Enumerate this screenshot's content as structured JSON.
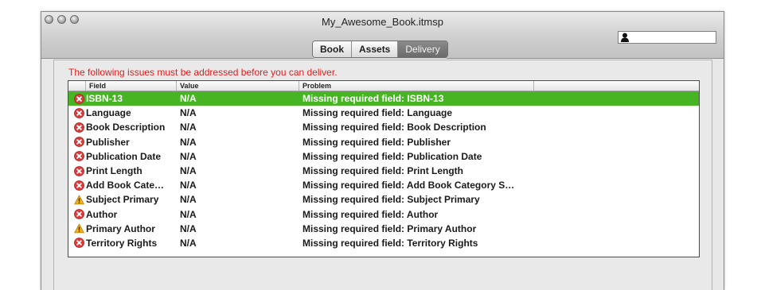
{
  "window": {
    "title": "My_Awesome_Book.itmsp"
  },
  "tabs": [
    {
      "label": "Book",
      "active": false
    },
    {
      "label": "Assets",
      "active": false
    },
    {
      "label": "Delivery",
      "active": true
    }
  ],
  "warning": "The following issues must be addressed before you can deliver.",
  "table": {
    "headers": {
      "field": "Field",
      "value": "Value",
      "problem": "Problem"
    },
    "rows": [
      {
        "icon": "error-icon",
        "field": "ISBN-13",
        "value": "N/A",
        "problem": "Missing required field: ISBN-13",
        "selected": true
      },
      {
        "icon": "error-icon",
        "field": "Language",
        "value": "N/A",
        "problem": "Missing required field: Language"
      },
      {
        "icon": "error-icon",
        "field": "Book Description",
        "value": "N/A",
        "problem": "Missing required field: Book Description"
      },
      {
        "icon": "error-icon",
        "field": "Publisher",
        "value": "N/A",
        "problem": "Missing required field: Publisher"
      },
      {
        "icon": "error-icon",
        "field": "Publication Date",
        "value": "N/A",
        "problem": "Missing required field: Publication Date"
      },
      {
        "icon": "error-icon",
        "field": "Print Length",
        "value": "N/A",
        "problem": "Missing required field: Print Length"
      },
      {
        "icon": "error-icon",
        "field": "Add Book Cate…",
        "value": "N/A",
        "problem": "Missing required field: Add Book Category S…"
      },
      {
        "icon": "warning-icon",
        "field": "Subject Primary",
        "value": "N/A",
        "problem": "Missing required field: Subject Primary"
      },
      {
        "icon": "error-icon",
        "field": "Author",
        "value": "N/A",
        "problem": "Missing required field: Author"
      },
      {
        "icon": "warning-icon",
        "field": "Primary Author",
        "value": "N/A",
        "problem": "Missing required field: Primary Author"
      },
      {
        "icon": "error-icon",
        "field": "Territory Rights",
        "value": "N/A",
        "problem": "Missing required field: Territory Rights"
      }
    ]
  },
  "colors": {
    "warning_text": "#e21c1c",
    "selection": "#47b523",
    "error_icon": "#d93a3a",
    "warning_icon": "#f2b21b"
  }
}
